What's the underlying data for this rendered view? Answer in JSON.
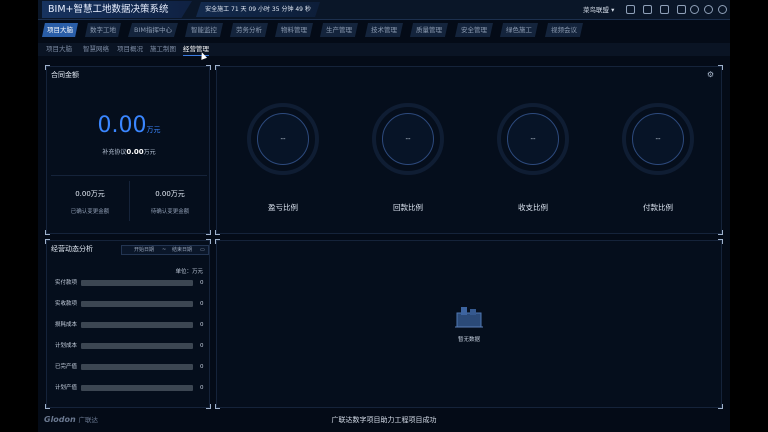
{
  "header": {
    "title": "BIM+智慧工地数据决策系统",
    "safety_text": "安全施工 71 天 09 小时 35 分钟 49 秒",
    "project": "菜鸟联盟 ▾",
    "icons": [
      "grid-icon",
      "monitor-icon",
      "picture-icon",
      "book-icon",
      "shield-icon",
      "refresh-icon",
      "user-icon"
    ]
  },
  "main_tabs": [
    "项目大脑",
    "数字工地",
    "BIM指挥中心",
    "智能监控",
    "劳务分析",
    "物料管理",
    "生产管理",
    "技术管理",
    "质量管理",
    "安全管理",
    "绿色施工",
    "视频会议"
  ],
  "active_main_tab": 0,
  "sub_tabs": [
    "项目大脑",
    "智慧网络",
    "项目概况",
    "施工制图",
    "经营管理"
  ],
  "active_sub_tab": 4,
  "contract": {
    "title": "合同金额",
    "value": "0.00",
    "unit": "万元",
    "supplement_label": "补充协议",
    "supplement_value": "0.00",
    "supplement_unit": "万元",
    "confirmed_value": "0.00万元",
    "confirmed_label": "已确认变更金额",
    "pending_value": "0.00万元",
    "pending_label": "待确认变更金额"
  },
  "gauges": [
    {
      "value": "--",
      "label": "盈亏比例"
    },
    {
      "value": "--",
      "label": "回款比例"
    },
    {
      "value": "--",
      "label": "收支比例"
    },
    {
      "value": "--",
      "label": "付款比例"
    }
  ],
  "dynamic": {
    "title": "经营动态分析",
    "start_placeholder": "开始日期",
    "separator": "~",
    "end_placeholder": "结束日期",
    "unit": "单位：万元",
    "rows": [
      {
        "label": "实付款项",
        "value": "0"
      },
      {
        "label": "实收款项",
        "value": "0"
      },
      {
        "label": "损耗成本",
        "value": "0"
      },
      {
        "label": "计划成本",
        "value": "0"
      },
      {
        "label": "已完产值",
        "value": "0"
      },
      {
        "label": "计划产值",
        "value": "0"
      }
    ]
  },
  "empty_state": {
    "text": "暂无数据"
  },
  "footer": {
    "logo": "Glodon",
    "logo_cn": "广联达",
    "text": "广联达数字项目助力工程项目成功"
  }
}
